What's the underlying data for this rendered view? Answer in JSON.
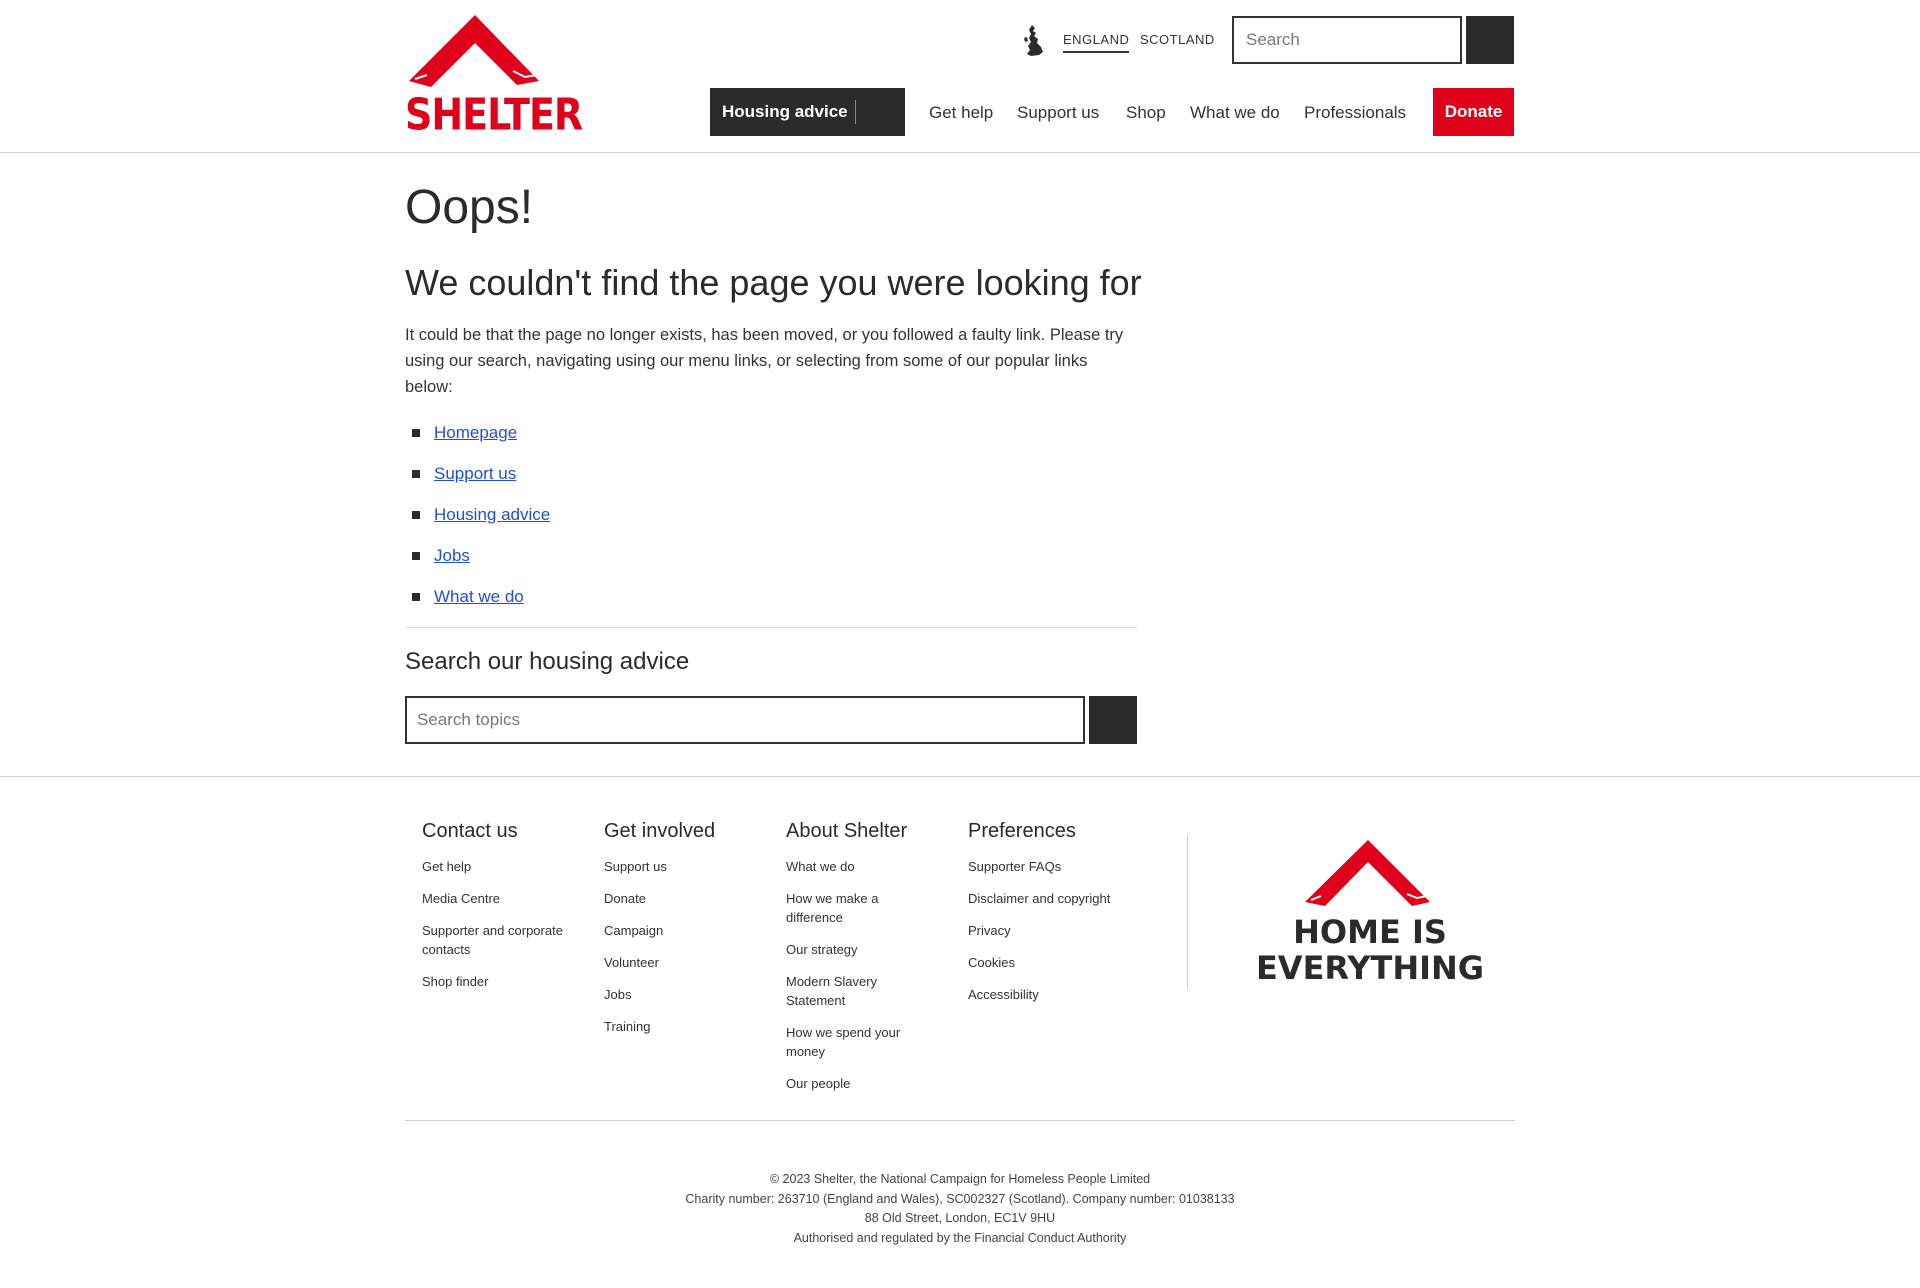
{
  "header": {
    "logo_text": "SHELTER",
    "regions": [
      "ENGLAND",
      "SCOTLAND"
    ],
    "search_placeholder": "Search",
    "nav": {
      "housing_advice": "Housing advice",
      "links": [
        "Get help",
        "Support us",
        "Shop",
        "What we do",
        "Professionals"
      ],
      "donate": "Donate"
    }
  },
  "main": {
    "title": "Oops!",
    "subtitle": "We couldn't find the page you were looking for",
    "intro": "It could be that the page no longer exists, has been moved, or you followed a faulty link. Please try using our search, navigating using our menu links, or selecting from some of our popular links below:",
    "popular_links": [
      "Homepage",
      "Support us",
      "Housing advice",
      "Jobs",
      "What we do"
    ],
    "search_heading": "Search our housing advice",
    "search_placeholder": "Search topics"
  },
  "footer": {
    "columns": [
      {
        "heading": "Contact us",
        "links": [
          "Get help",
          "Media Centre",
          "Supporter and corporate contacts",
          "Shop finder"
        ]
      },
      {
        "heading": "Get involved",
        "links": [
          "Support us",
          "Donate",
          "Campaign",
          "Volunteer",
          "Jobs",
          "Training"
        ]
      },
      {
        "heading": "About Shelter",
        "links": [
          "What we do",
          "How we make a difference",
          "Our strategy",
          "Modern Slavery Statement",
          "How we spend your money",
          "Our people"
        ]
      },
      {
        "heading": "Preferences",
        "links": [
          "Supporter FAQs",
          "Disclaimer and copyright",
          "Privacy",
          "Cookies",
          "Accessibility"
        ]
      }
    ],
    "tagline_line1": "HOME IS",
    "tagline_line2": "EVERYTHING",
    "legal": [
      "© 2023 Shelter, the National Campaign for Homeless People Limited",
      "Charity number: 263710 (England and Wales), SC002327 (Scotland). Company number: 01038133",
      "88 Old Street, London, EC1V 9HU",
      "Authorised and regulated by the Financial Conduct Authority"
    ]
  },
  "colors": {
    "brand_red": "#e1001a",
    "dark": "#2b2b2b",
    "link_blue": "#1f4fd6"
  }
}
